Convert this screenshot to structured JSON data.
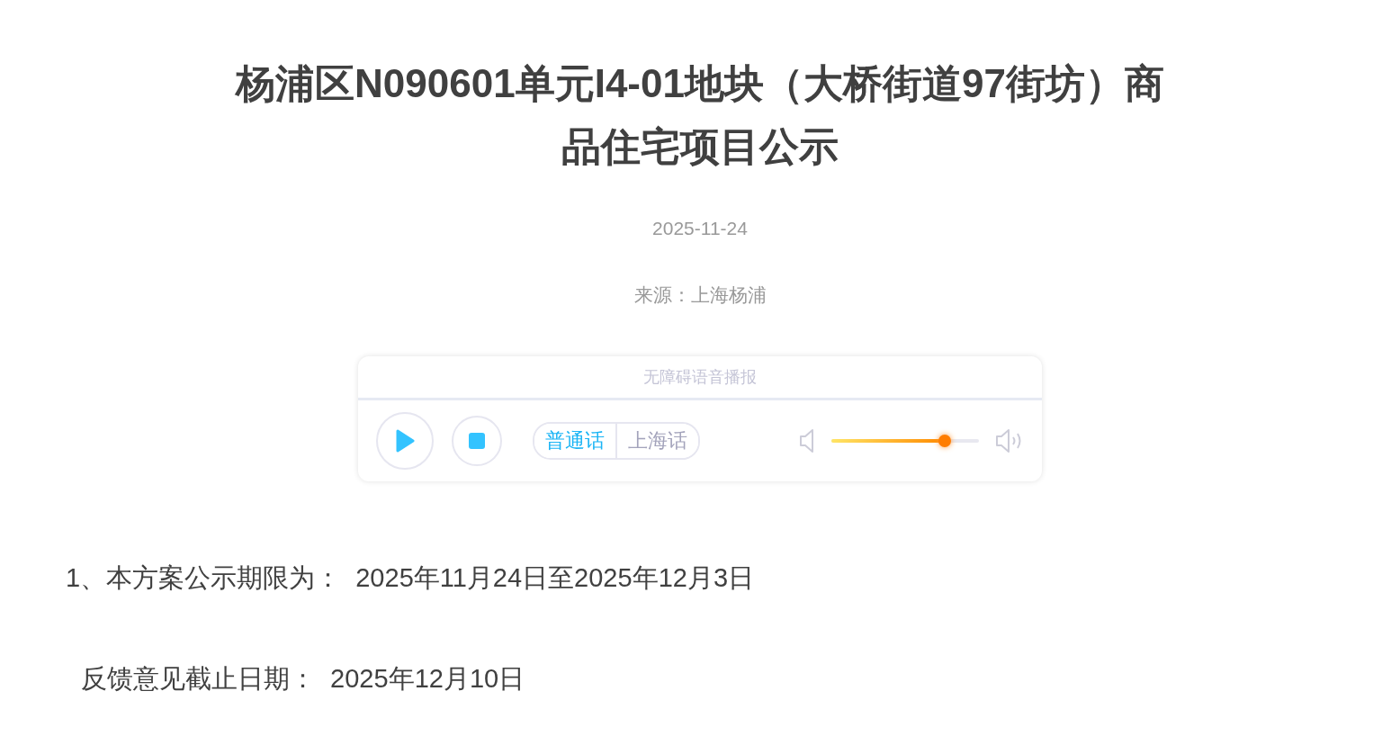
{
  "title": "杨浦区N090601单元I4-01地块（大桥街道97街坊）商品住宅项目公示",
  "date": "2025-11-24",
  "source": "来源：上海杨浦",
  "player": {
    "heading": "无障碍语音播报",
    "dialects": [
      {
        "label": "普通话",
        "selected": true
      },
      {
        "label": "上海话",
        "selected": false
      }
    ],
    "volume": {
      "level": 0.77
    }
  },
  "paragraphs": [
    "1、本方案公示期限为：  2025年11月24日至2025年12月3日",
    "反馈意见截止日期：  2025年12月10日"
  ]
}
